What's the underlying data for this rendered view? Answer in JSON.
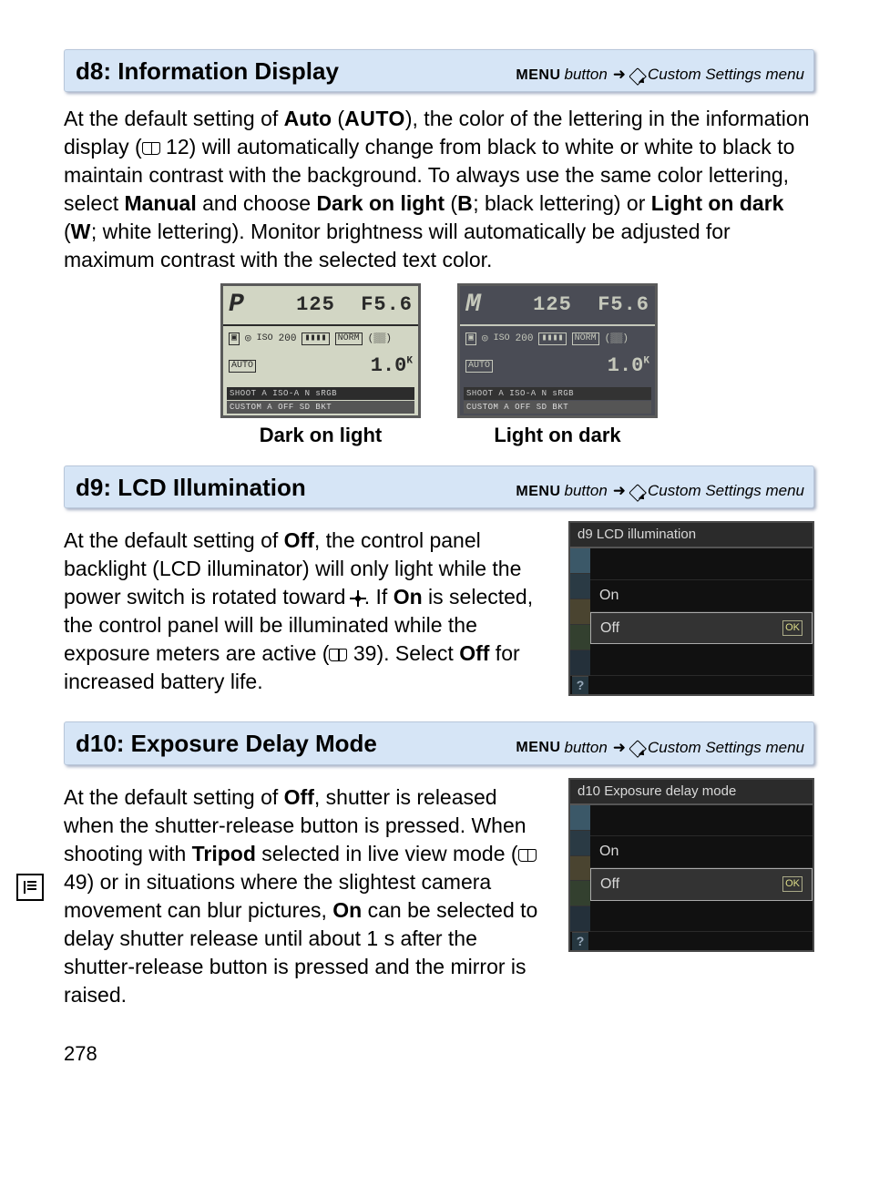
{
  "sections": {
    "d8": {
      "title": "d8: Information Display",
      "menu_label": "MENU",
      "menu_button": "button",
      "menu_path_tail": "Custom Settings menu",
      "body_1a": "At the default setting of ",
      "auto_label": "Auto",
      "auto_mono": "AUTO",
      "body_1b": "), the color of the lettering in the information display (",
      "page_ref_12": "12",
      "body_1c": ") will automatically change from black to white or white to black to maintain contrast with the background. To always use the same color lettering, select ",
      "manual_label": "Manual",
      "body_1d": " and choose ",
      "dark_on_light": "Dark on light",
      "b_mono": "B",
      "body_1e": "; black lettering) or ",
      "light_on_dark": "Light on dark",
      "w_mono": "W",
      "body_1f": "; white lettering).  Monitor brightness will automatically be adjusted for maximum contrast with the selected text color.",
      "lcd_light_caption": "Dark on light",
      "lcd_dark_caption": "Light on dark",
      "lcd_light": {
        "mode": "P",
        "shutter": "125",
        "aperture": "F5.6",
        "iso": "200",
        "center": "AUTO",
        "comp": "1.0",
        "barA": "SHOOT A  ISO-A N  sRGB",
        "barB": "CUSTOM A  OFF  SD  BKT"
      },
      "lcd_dark": {
        "mode": "M",
        "shutter": "125",
        "aperture": "F5.6",
        "iso": "200",
        "center": "AUTO",
        "comp": "1.0",
        "barA": "SHOOT A  ISO-A N  sRGB",
        "barB": "CUSTOM A  OFF  SD  BKT"
      }
    },
    "d9": {
      "title": "d9: LCD Illumination",
      "menu_label": "MENU",
      "menu_button": "button",
      "menu_path_tail": "Custom Settings menu",
      "body_a": "At the default setting of ",
      "off": "Off",
      "body_b": ", the control panel backlight (LCD illuminator) will only light while the power switch is rotated toward ",
      "body_c": ". If ",
      "on": "On",
      "body_d": " is selected, the control panel will be illuminated while the exposure meters are active (",
      "page_ref_39": "39",
      "body_e": "). Select ",
      "body_f": " for increased battery life.",
      "ms_title": "d9 LCD illumination",
      "ms_on": "On",
      "ms_off": "Off",
      "ms_ok": "OK"
    },
    "d10": {
      "title": "d10: Exposure Delay Mode",
      "menu_label": "MENU",
      "menu_button": "button",
      "menu_path_tail": "Custom Settings menu",
      "body_a": "At the default setting of ",
      "off": "Off",
      "body_b": ", shutter is released when the shutter-release button is pressed. When shooting with ",
      "tripod": "Tripod",
      "body_c": " selected in live view mode (",
      "page_ref_49": "49",
      "body_d": ") or in situations where the slightest camera movement can blur pictures, ",
      "on": "On",
      "body_e": " can be selected to delay shutter release until about 1 s after the shutter-release button is pressed and the mirror is raised.",
      "ms_title": "d10 Exposure delay mode",
      "ms_on": "On",
      "ms_off": "Off",
      "ms_ok": "OK"
    }
  },
  "page_number": "278"
}
